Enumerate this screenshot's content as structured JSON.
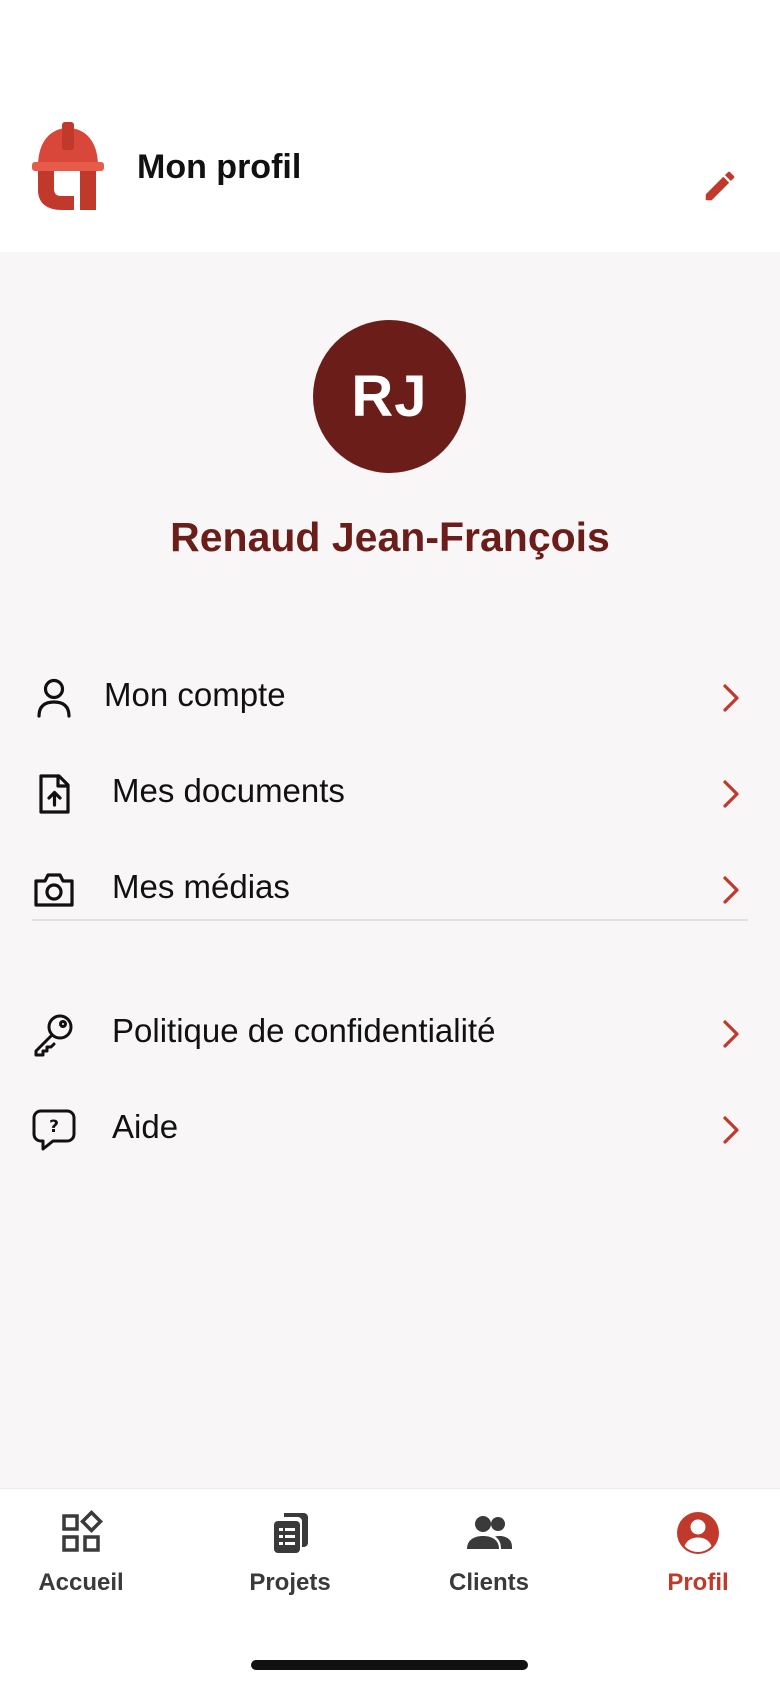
{
  "header": {
    "title": "Mon profil",
    "logo_icon": "hardhat-logo-icon",
    "edit_icon": "pencil-icon"
  },
  "profile": {
    "initials": "RJ",
    "name": "Renaud Jean-François"
  },
  "menu": {
    "items": [
      {
        "label": "Mon compte",
        "icon": "user-icon"
      },
      {
        "label": "Mes documents",
        "icon": "file-upload-icon"
      },
      {
        "label": "Mes médias",
        "icon": "camera-icon"
      },
      {
        "label": "Politique de confidentialité",
        "icon": "key-icon"
      },
      {
        "label": "Aide",
        "icon": "help-bubble-icon"
      }
    ]
  },
  "nav": {
    "items": [
      {
        "label": "Accueil",
        "icon": "apps-icon",
        "active": false
      },
      {
        "label": "Projets",
        "icon": "documents-icon",
        "active": false
      },
      {
        "label": "Clients",
        "icon": "people-icon",
        "active": false
      },
      {
        "label": "Profil",
        "icon": "account-circle-icon",
        "active": true
      }
    ]
  },
  "colors": {
    "brand": "#c0392b",
    "avatar_bg": "#6b1e19",
    "name_text": "#6b1e19",
    "chevron": "#c0392b",
    "background": "#f8f6f6"
  }
}
